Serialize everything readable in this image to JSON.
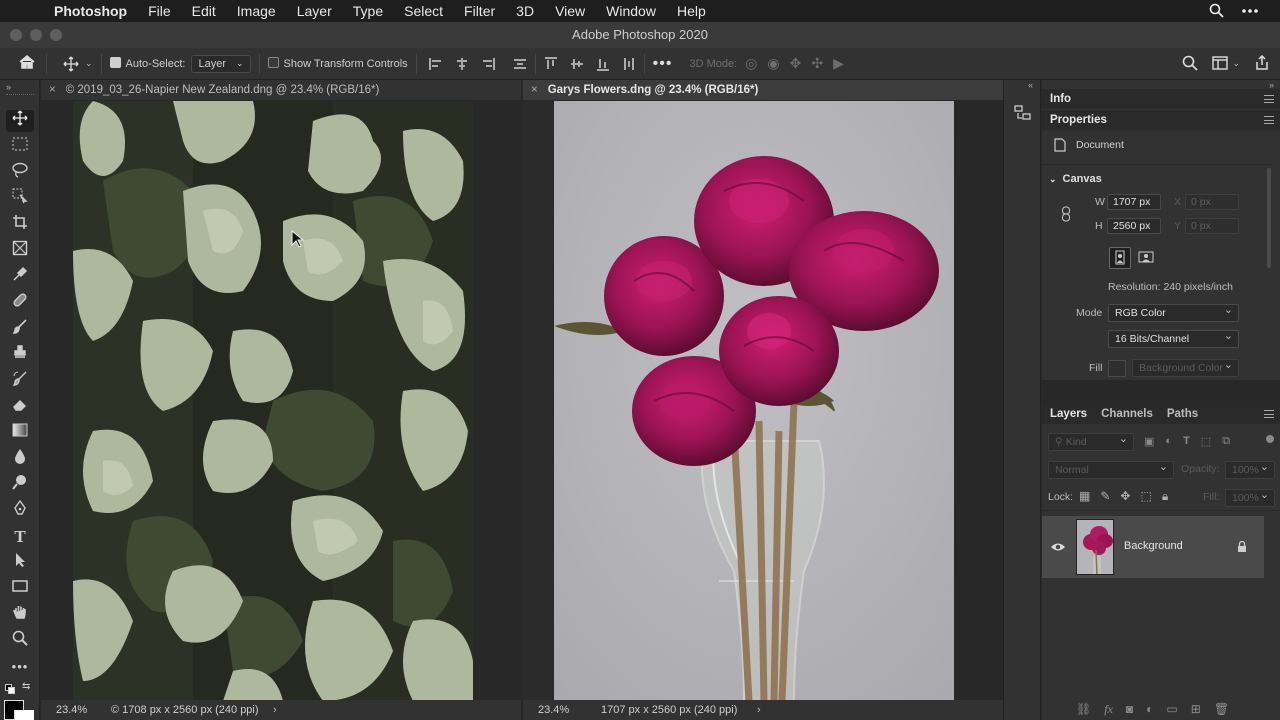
{
  "menubar": {
    "app": "Photoshop",
    "items": [
      "File",
      "Edit",
      "Image",
      "Layer",
      "Type",
      "Select",
      "Filter",
      "3D",
      "View",
      "Window",
      "Help"
    ]
  },
  "window": {
    "title": "Adobe Photoshop 2020"
  },
  "options": {
    "auto_select_label": "Auto-Select:",
    "auto_select_value": "Layer",
    "transform_label": "Show Transform Controls",
    "mode_3d_label": "3D Mode:"
  },
  "tools": [
    "move-icon",
    "marquee-icon",
    "lasso-icon",
    "object-select-icon",
    "crop-icon",
    "frame-icon",
    "eyedropper-icon",
    "healing-icon",
    "brush-icon",
    "stamp-icon",
    "history-brush-icon",
    "eraser-icon",
    "gradient-icon",
    "blur-icon",
    "dodge-icon",
    "pen-icon",
    "type-icon",
    "path-select-icon",
    "rectangle-icon",
    "hand-icon",
    "zoom-icon",
    "more-icon"
  ],
  "documents": [
    {
      "tab": "© 2019_03_26-Napier New Zealand.dng @ 23.4% (RGB/16*)",
      "zoom": "23.4%",
      "status": "© 1708 px x 2560 px (240 ppi)"
    },
    {
      "tab": "Garys Flowers.dng @ 23.4% (RGB/16*)",
      "zoom": "23.4%",
      "status": "1707 px x 2560 px (240 ppi)"
    }
  ],
  "info_panel": {
    "tab": "Info"
  },
  "properties": {
    "tab": "Properties",
    "doc_label": "Document",
    "canvas_label": "Canvas",
    "w_label": "W",
    "w_value": "1707 px",
    "h_label": "H",
    "h_value": "2560 px",
    "x_label": "X",
    "x_placeholder": "0 px",
    "y_label": "Y",
    "y_placeholder": "0 px",
    "resolution": "Resolution: 240 pixels/inch",
    "mode_label": "Mode",
    "mode_value": "RGB Color",
    "depth_value": "16 Bits/Channel",
    "fill_label": "Fill",
    "fill_value": "Background Color"
  },
  "layers_panel": {
    "tabs": [
      "Layers",
      "Channels",
      "Paths"
    ],
    "kind_label": "Kind",
    "blend_mode": "Normal",
    "opacity_label": "Opacity:",
    "opacity_value": "100%",
    "lock_label": "Lock:",
    "fill_label": "Fill:",
    "fill_value": "100%",
    "layers": [
      {
        "name": "Background",
        "visible": true,
        "locked": true
      }
    ]
  },
  "colors": {
    "accent": "#1473e6",
    "panel_bg": "#323232",
    "canvas_bg": "#282828",
    "flower_bg": "#b6b5b9",
    "rose": "#a5185a"
  }
}
